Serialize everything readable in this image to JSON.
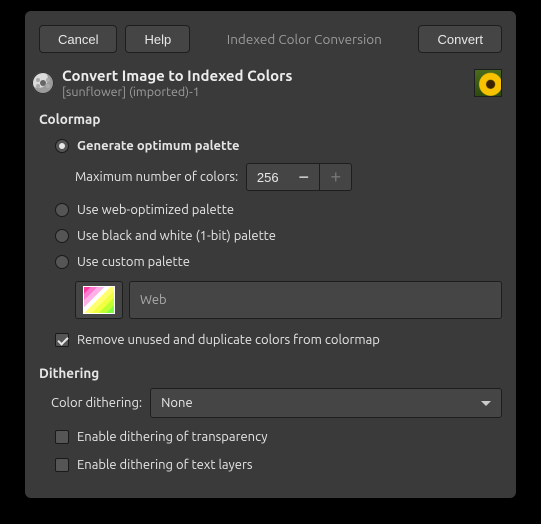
{
  "toolbar": {
    "cancel": "Cancel",
    "help": "Help",
    "title": "Indexed Color Conversion",
    "convert": "Convert"
  },
  "header": {
    "title": "Convert Image to Indexed Colors",
    "subtitle": "[sunflower] (imported)-1"
  },
  "colormap": {
    "section": "Colormap",
    "opt_generate": "Generate optimum palette",
    "max_label": "Maximum number of colors:",
    "max_value": "256",
    "opt_web": "Use web-optimized palette",
    "opt_bw": "Use black and white (1-bit) palette",
    "opt_custom": "Use custom palette",
    "custom_name": "Web",
    "remove_dup": "Remove unused and duplicate colors from colormap"
  },
  "dithering": {
    "section": "Dithering",
    "label": "Color dithering:",
    "value": "None",
    "transparency": "Enable dithering of transparency",
    "text_layers": "Enable dithering of text layers"
  }
}
